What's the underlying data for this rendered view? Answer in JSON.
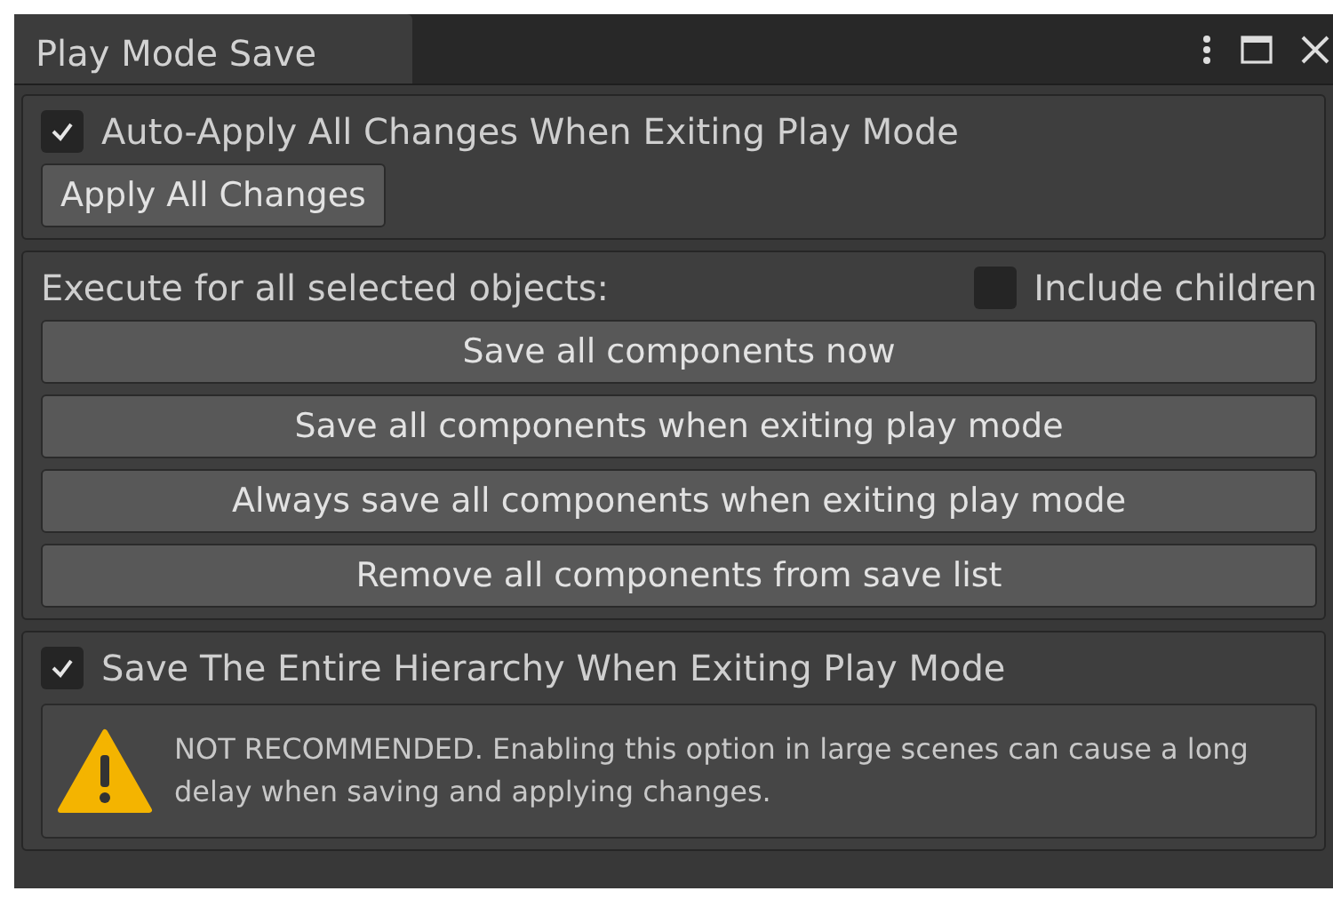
{
  "window": {
    "tab": "Play Mode Save"
  },
  "auto_apply": {
    "label": "Auto-Apply All Changes When Exiting Play Mode",
    "checked": true
  },
  "apply_button": "Apply All Changes",
  "selection": {
    "label": "Execute for all selected objects:",
    "include_children": {
      "label": "Include children",
      "checked": false
    },
    "buttons": [
      "Save all components now",
      "Save all components when exiting play mode",
      "Always save all components when exiting play mode",
      "Remove all components from save list"
    ]
  },
  "hierarchy": {
    "label": "Save The Entire Hierarchy When Exiting Play Mode",
    "checked": true
  },
  "warning": "NOT RECOMMENDED. Enabling this option in large scenes can cause a long delay when saving and applying changes."
}
